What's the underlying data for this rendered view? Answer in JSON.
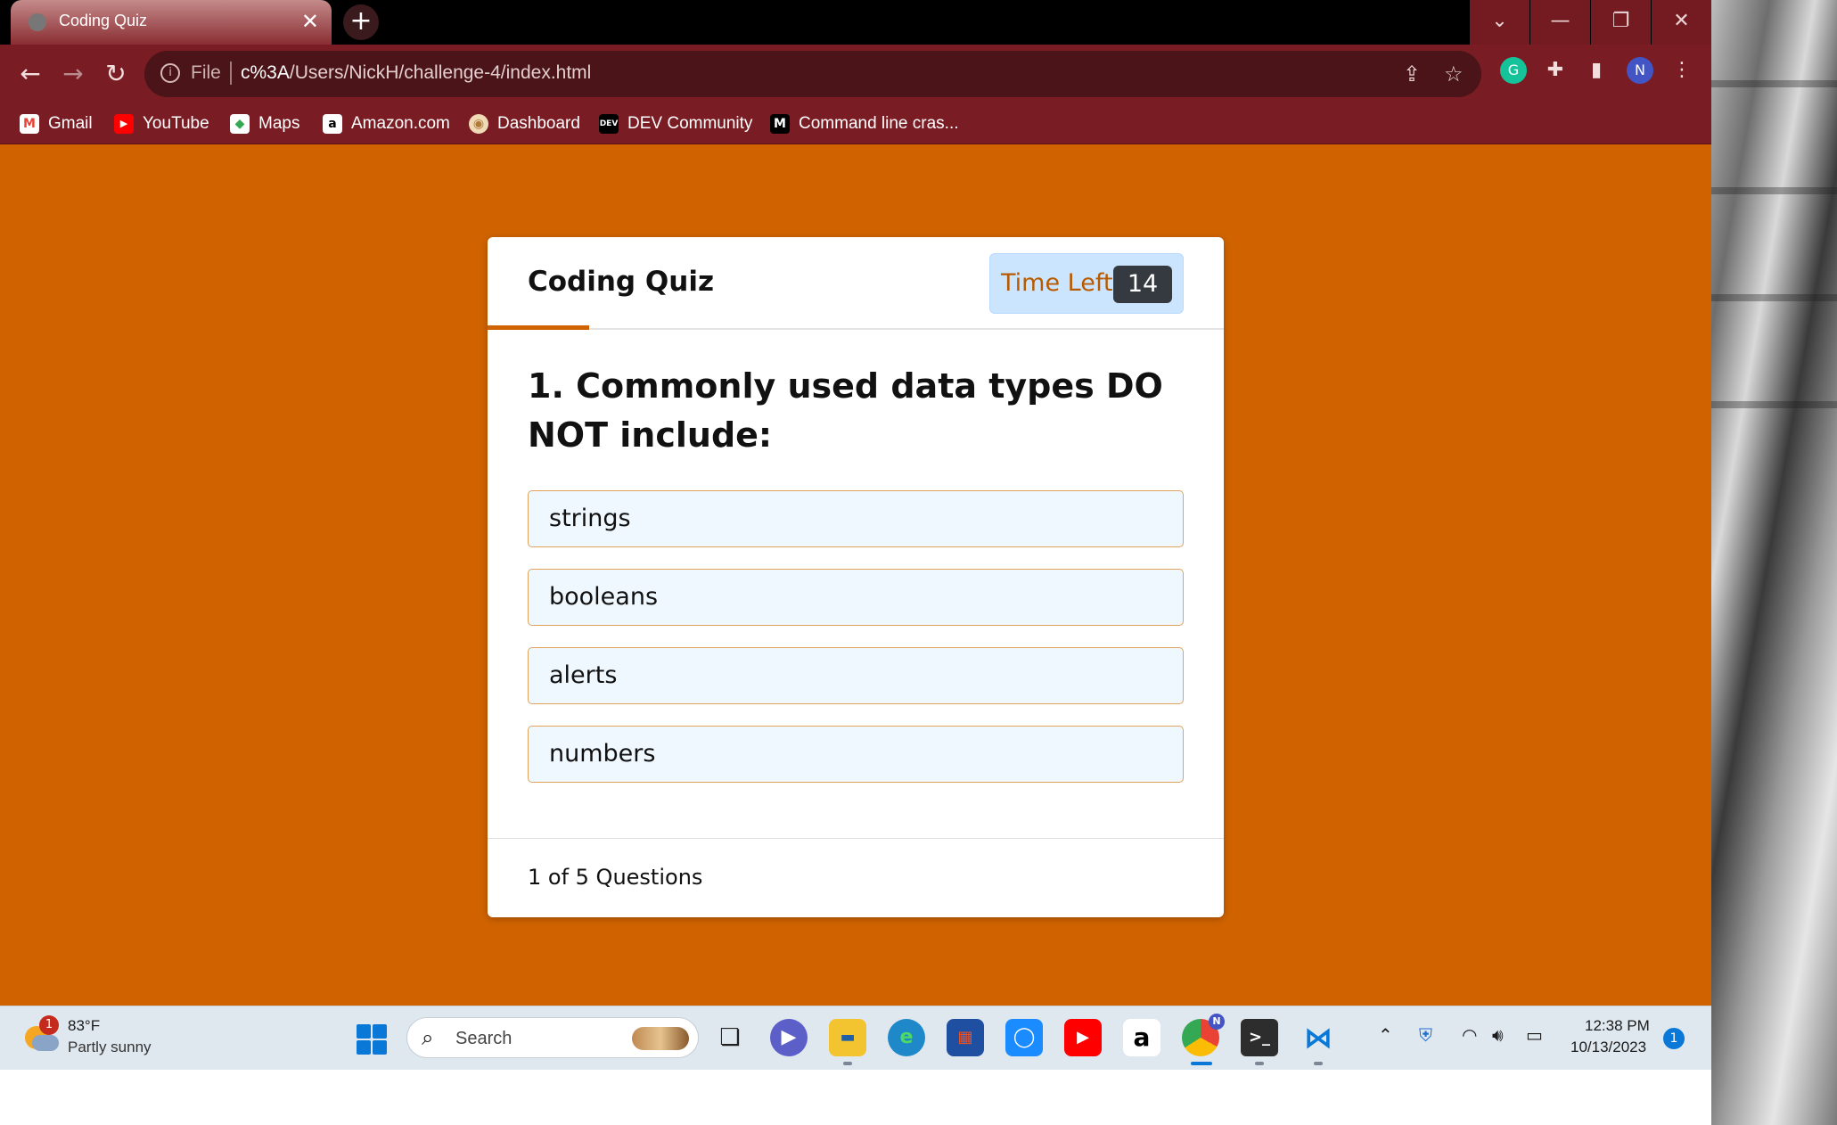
{
  "browser": {
    "tab_title": "Coding Quiz",
    "tab_close": "✕",
    "new_tab": "+",
    "window_controls": [
      "⌄",
      "—",
      "❐",
      "✕"
    ],
    "omnibox": {
      "scheme_label": "File",
      "url_host": "c%3A",
      "url_path": "/Users/NickH/challenge-4/index.html"
    },
    "profile_initial": "N",
    "extension_initial": "G",
    "bookmarks": [
      {
        "label": "Gmail",
        "icon": "gmail-icon",
        "glyph": "M",
        "color": "#ea4335"
      },
      {
        "label": "YouTube",
        "icon": "youtube-icon",
        "glyph": "▶",
        "color": "#ff0000"
      },
      {
        "label": "Maps",
        "icon": "maps-icon",
        "glyph": "◆",
        "color": "#34a853"
      },
      {
        "label": "Amazon.com",
        "icon": "amazon-icon",
        "glyph": "a",
        "color": "#ffffff"
      },
      {
        "label": "Dashboard",
        "icon": "dashboard-icon",
        "glyph": "◉",
        "color": "#f0d9b5"
      },
      {
        "label": "DEV Community",
        "icon": "dev-icon",
        "glyph": "DEV",
        "color": "#000000"
      },
      {
        "label": "Command line cras...",
        "icon": "medium-icon",
        "glyph": "M",
        "color": "#000000"
      }
    ]
  },
  "quiz": {
    "title": "Coding Quiz",
    "timer_label": "Time Left",
    "timer_value": "14",
    "progress_fraction": 0.2,
    "question": "1. Commonly used data types DO NOT include:",
    "options": [
      "strings",
      "booleans",
      "alerts",
      "numbers"
    ],
    "footer": "1 of 5 Questions"
  },
  "colors": {
    "page_background": "#d06300",
    "chrome_frame": "#7a1c23",
    "timer_background": "#cce5ff",
    "option_background": "#f0f8ff",
    "option_border": "#e1a35b"
  },
  "taskbar": {
    "weather_badge": "1",
    "temperature": "83°F",
    "condition": "Partly sunny",
    "search_label": "Search",
    "clock_time": "12:38 PM",
    "clock_date": "10/13/2023",
    "notification_count": "1",
    "chrome_badge": "N"
  }
}
